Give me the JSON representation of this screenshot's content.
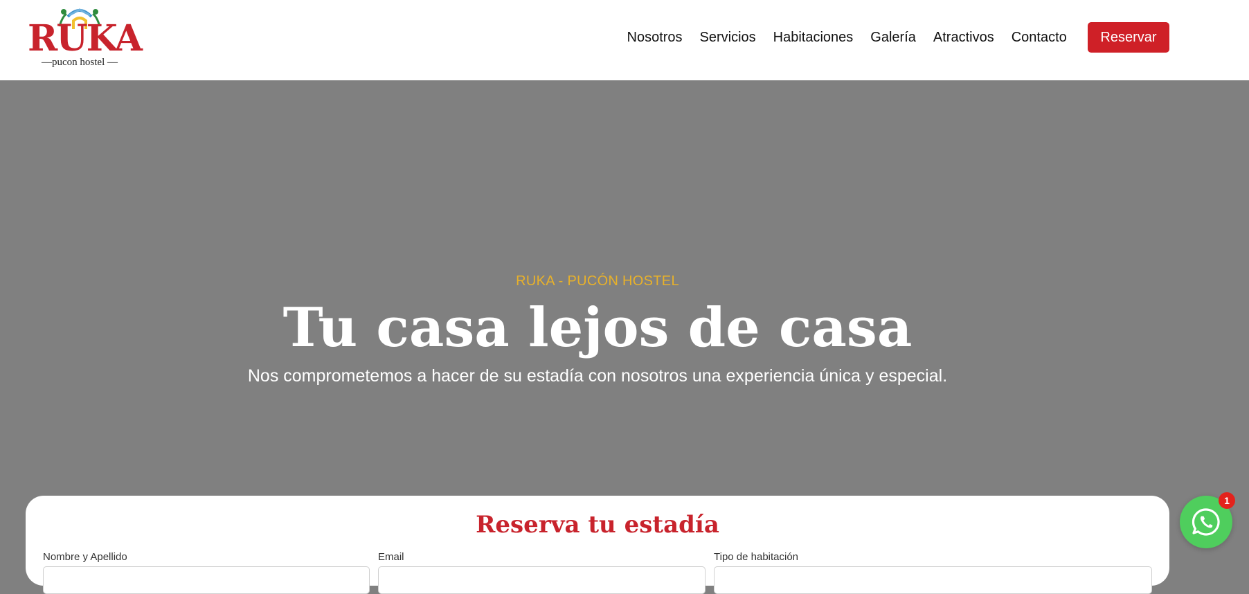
{
  "brand": {
    "logo_word": "RUKA",
    "logo_sub": "—pucon hostel —",
    "colors": {
      "primary_red": "#cf2027",
      "accent_yellow": "#e8b12a",
      "hero_bg": "#808080",
      "whatsapp_green": "#4fce5d"
    }
  },
  "nav": {
    "items": [
      {
        "label": "Nosotros"
      },
      {
        "label": "Servicios"
      },
      {
        "label": "Habitaciones"
      },
      {
        "label": "Galería"
      },
      {
        "label": "Atractivos"
      },
      {
        "label": "Contacto"
      }
    ],
    "cta_label": "Reservar"
  },
  "hero": {
    "tag": "RUKA - PUCÓN HOSTEL",
    "title": "Tu casa lejos de casa",
    "subtitle": "Nos comprometemos a hacer de su estadía con nosotros una experiencia única y especial."
  },
  "booking": {
    "title": "Reserva tu estadía",
    "fields": [
      {
        "label": "Nombre y Apellido"
      },
      {
        "label": "Email"
      },
      {
        "label": "Tipo de habitación"
      }
    ]
  },
  "whatsapp": {
    "icon": "whatsapp-icon",
    "badge_count": "1"
  }
}
